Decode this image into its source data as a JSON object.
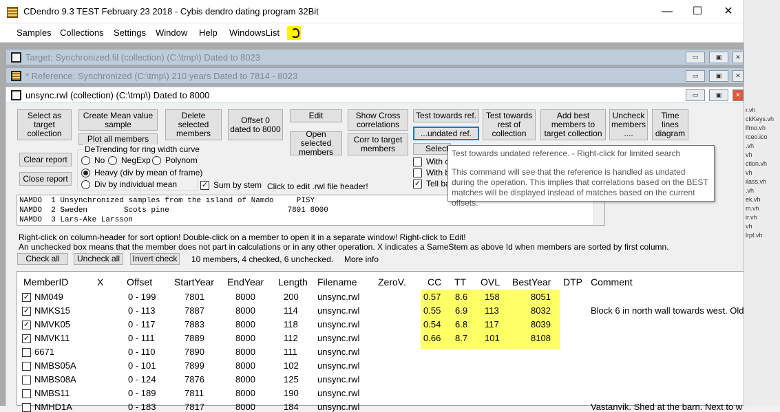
{
  "app": {
    "title": "CDendro 9.3  TEST February 23 2018 - Cybis dendro dating program  32Bit",
    "min": "—",
    "max": "☐",
    "close": "✕"
  },
  "menu": [
    "Samples",
    "Collections",
    "Settings",
    "Window",
    "Help",
    "WindowsList"
  ],
  "windows": {
    "target": "Target: Synchronized.fil (collection)  (C:\\tmp\\)  Dated to 8023",
    "reference": "* Reference: Synchronized   (C:\\tmp\\)  210 years  Dated to 7814 - 8023",
    "active": "unsync.rwl (collection)  (C:\\tmp\\) Dated to 8000"
  },
  "buttons": {
    "select_target": "Select as target collection",
    "create_mean": "Create Mean value sample",
    "plot_all": "Plot all members",
    "delete_selected": "Delete selected members",
    "offset0": "Offset 0 dated to 8000",
    "edit": "Edit",
    "open_selected": "Open selected members",
    "show_cross": "Show Cross correlations",
    "corr_target": "Corr to target members",
    "test_ref": "Test towards ref.",
    "undated_ref": "...undated ref.",
    "select": "Select",
    "test_rest": "Test towards rest of collection",
    "add_best": "Add best members to target collection",
    "uncheck_members": "Uncheck members ....",
    "time_lines": "Time lines diagram",
    "clear_report": "Clear report",
    "close_report": "Close report",
    "check_all": "Check all",
    "uncheck_all": "Uncheck all",
    "invert_check": "Invert check"
  },
  "detrending": {
    "title": "DeTrending for ring width curve",
    "no": "No",
    "negexp": "NegExp",
    "polynom": "Polynom",
    "heavy": "Heavy (div by mean of frame)",
    "div_individual": "Div by individual mean",
    "selected": "heavy"
  },
  "options": {
    "sum_by_stem": "Sum by stem",
    "sum_by_stem_checked": true,
    "with_c": "With c",
    "with_b": "With b",
    "tell_ba": "Tell ba",
    "click_edit": "Click to edit .rwl file header!"
  },
  "report_lines": [
    "NAMDO  1 Unsynchronized samples from the island of Namdo     PISY",
    "NAMDO  2 Sweden        Scots pine                          7801 8000",
    "NAMDO  3 Lars-Ake Larsson"
  ],
  "hints": {
    "line1": "Right-click on column-header for sort option! Double-click on a member to open it in a separate window! Right-click to Edit!",
    "line2": "An unchecked box means that the member does not part in calculations or in any other operation.  X indicates a SameStem as above Id when members are sorted by first column.",
    "counts": "10 members, 4 checked, 6 unchecked.",
    "more_info": "More info"
  },
  "tooltip": {
    "line1": "Test towards undated reference. - Right-click for limited search",
    "line2": "This command will see that the reference is handled as undated during the operation. This implies that correlations based on the BEST matches will be displayed instead of matches based on the current offsets."
  },
  "grid": {
    "headers": [
      "MemberID",
      "X",
      "Offset",
      "StartYear",
      "EndYear",
      "Length",
      "Filename",
      "ZeroV.",
      "CC",
      "TT",
      "OVL",
      "BestYear",
      "DTP",
      "Comment"
    ],
    "rows": [
      {
        "checked": true,
        "id": "NM049",
        "offset": "0 - 199",
        "start": "7801",
        "end": "8000",
        "length": "200",
        "file": "unsync.rwl",
        "cc": "0.57",
        "tt": "8.6",
        "ovl": "158",
        "best": "8051",
        "comment": ""
      },
      {
        "checked": true,
        "id": "NMKS15",
        "offset": "0 - 113",
        "start": "7887",
        "end": "8000",
        "length": "114",
        "file": "unsync.rwl",
        "cc": "0.55",
        "tt": "6.9",
        "ovl": "113",
        "best": "8032",
        "comment": "Block 6 in north wall towards west. Old c"
      },
      {
        "checked": true,
        "id": "NMVK05",
        "offset": "0 - 117",
        "start": "7883",
        "end": "8000",
        "length": "118",
        "file": "unsync.rwl",
        "cc": "0.54",
        "tt": "6.8",
        "ovl": "117",
        "best": "8039",
        "comment": ""
      },
      {
        "checked": true,
        "id": "NMVK11",
        "offset": "0 - 111",
        "start": "7889",
        "end": "8000",
        "length": "112",
        "file": "unsync.rwl",
        "cc": "0.66",
        "tt": "8.7",
        "ovl": "101",
        "best": "8108",
        "comment": ""
      },
      {
        "checked": false,
        "id": "6671",
        "offset": "0 - 110",
        "start": "7890",
        "end": "8000",
        "length": "111",
        "file": "unsync.rwl",
        "cc": "",
        "tt": "",
        "ovl": "",
        "best": "",
        "comment": ""
      },
      {
        "checked": false,
        "id": "NMBS05A",
        "offset": "0 - 101",
        "start": "7899",
        "end": "8000",
        "length": "102",
        "file": "unsync.rwl",
        "cc": "",
        "tt": "",
        "ovl": "",
        "best": "",
        "comment": ""
      },
      {
        "checked": false,
        "id": "NMBS08A",
        "offset": "0 - 124",
        "start": "7876",
        "end": "8000",
        "length": "125",
        "file": "unsync.rwl",
        "cc": "",
        "tt": "",
        "ovl": "",
        "best": "",
        "comment": ""
      },
      {
        "checked": false,
        "id": "NMBS11",
        "offset": "0 - 189",
        "start": "7811",
        "end": "8000",
        "length": "190",
        "file": "unsync.rwl",
        "cc": "",
        "tt": "",
        "ovl": "",
        "best": "",
        "comment": ""
      },
      {
        "checked": false,
        "id": "NMHD1A",
        "offset": "0 - 183",
        "start": "7817",
        "end": "8000",
        "length": "184",
        "file": "unsync.rwl",
        "cc": "",
        "tt": "",
        "ovl": "",
        "best": "",
        "comment": "Vastanvik. Shed at the barn. Next to w"
      }
    ]
  },
  "right_list": [
    "r.vh",
    "ckKeys.vh",
    "lfmo.vh",
    "rceo.ico",
    ".vh",
    "vh",
    "ction.vh",
    "vh",
    "ilass.vh",
    ".vh",
    "ek.vh",
    "m.vh",
    "ir.vh",
    "vh",
    "lrpt.vh"
  ]
}
